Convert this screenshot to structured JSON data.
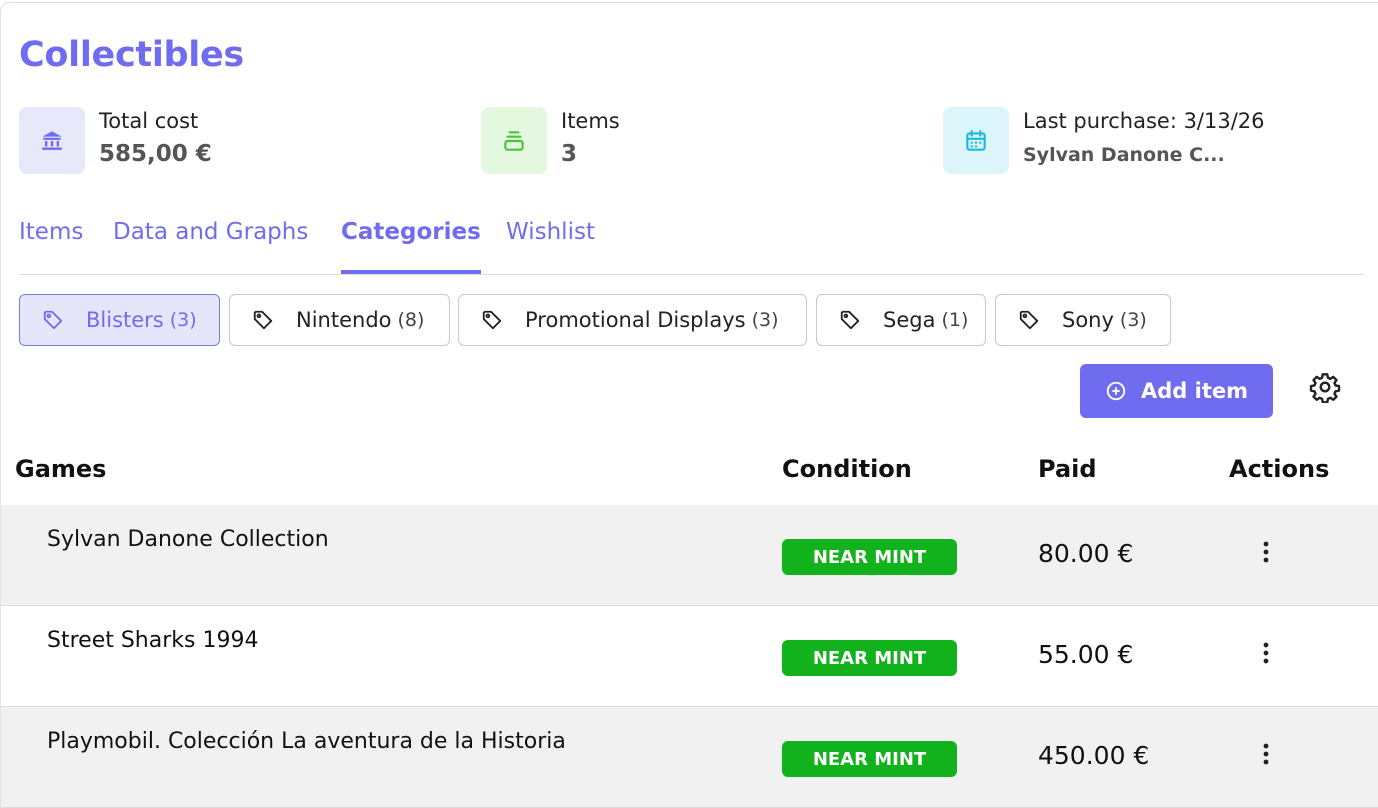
{
  "page": {
    "title": "Collectibles"
  },
  "stats": [
    {
      "icon": "bank-icon",
      "label": "Total cost",
      "value": "585,00 €",
      "color": "#6f6cf0",
      "bg": "#e8e8fb"
    },
    {
      "icon": "stack-icon",
      "label": "Items",
      "value": "3",
      "color": "#4cc33a",
      "bg": "#e4f8e0"
    },
    {
      "icon": "calendar-icon",
      "label": "Last purchase: 3/13/26",
      "value": "Sylvan Danone C...",
      "color": "#1eb7e0",
      "bg": "#dcf5fb"
    }
  ],
  "tabs": [
    {
      "label": "Items",
      "active": false
    },
    {
      "label": "Data and Graphs",
      "active": false
    },
    {
      "label": "Categories",
      "active": true
    },
    {
      "label": "Wishlist",
      "active": false
    }
  ],
  "categories": [
    {
      "label": "Blisters",
      "count": "(3)",
      "active": true
    },
    {
      "label": "Nintendo",
      "count": "(8)",
      "active": false
    },
    {
      "label": "Promotional Displays",
      "count": "(3)",
      "active": false
    },
    {
      "label": "Sega",
      "count": "(1)",
      "active": false
    },
    {
      "label": "Sony",
      "count": "(3)",
      "active": false
    }
  ],
  "toolbar": {
    "add_label": "Add item",
    "settings_icon": "gear-icon"
  },
  "table": {
    "columns": [
      "Games",
      "Condition",
      "Paid",
      "Actions"
    ],
    "rows": [
      {
        "name": "Sylvan Danone Collection",
        "condition": "NEAR MINT",
        "paid": "80.00 €"
      },
      {
        "name": "Street Sharks 1994",
        "condition": "NEAR MINT",
        "paid": "55.00 €"
      },
      {
        "name": "Playmobil. Colección La aventura de la Historia",
        "condition": "NEAR MINT",
        "paid": "450.00 €"
      }
    ]
  },
  "colors": {
    "accent": "#6f6cf0",
    "badge": "#12b21c"
  }
}
